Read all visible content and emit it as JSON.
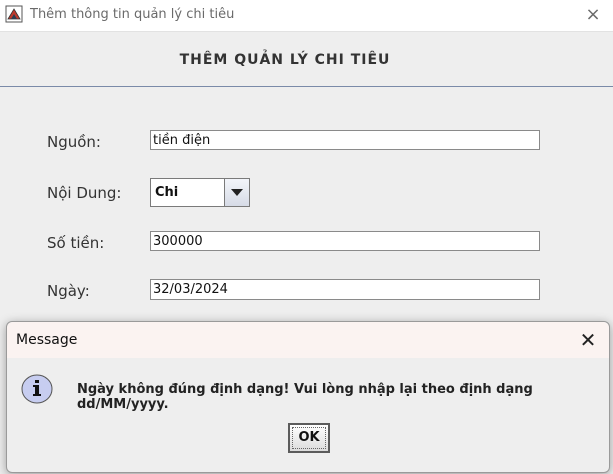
{
  "window": {
    "title": "Thêm thông tin quản lý chi tiêu",
    "close_glyph": "×"
  },
  "form": {
    "heading": "THÊM QUẢN LÝ CHI TIÊU",
    "fields": {
      "source": {
        "label": "Nguồn:",
        "value": "tiền điện"
      },
      "content": {
        "label": "Nội Dung:",
        "value": "Chi"
      },
      "amount": {
        "label": "Số tiền:",
        "value": "300000"
      },
      "date": {
        "label": "Ngày:",
        "value": "32/03/2024"
      }
    }
  },
  "dialog": {
    "title": "Message",
    "message": "Ngày không đúng định dạng! Vui lòng nhập lại theo định dạng dd/MM/yyyy.",
    "ok_label": "OK",
    "close_glyph": "✕",
    "icon": "info-icon"
  },
  "colors": {
    "heading_line": "#7a8aa8",
    "dialog_title_bg": "#fbf3f1",
    "info_icon_fill": "#c7cdf0"
  }
}
